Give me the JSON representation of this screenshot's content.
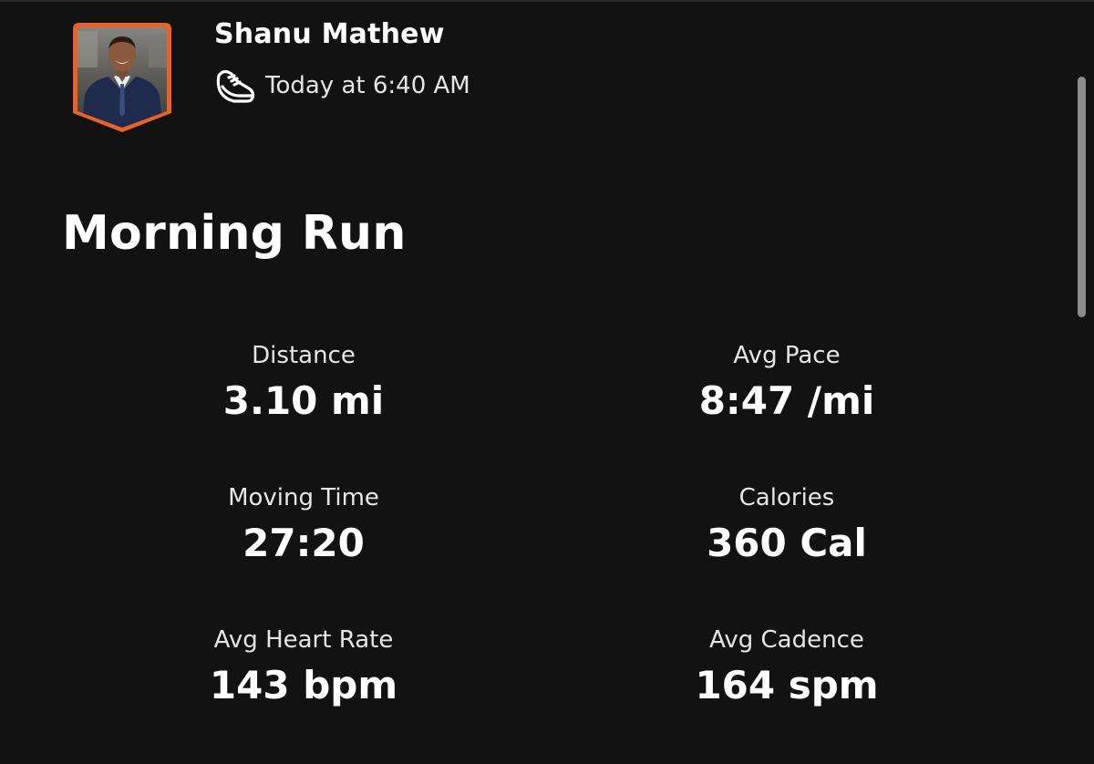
{
  "athlete": {
    "name": "Shanu Mathew",
    "avatar_icon": "athlete-avatar",
    "avatar_border_color": "#e8622c"
  },
  "activity": {
    "sport_icon": "running-shoe-icon",
    "timestamp": "Today at 6:40 AM",
    "title": "Morning Run"
  },
  "stats": [
    {
      "label": "Distance",
      "value": "3.10 mi"
    },
    {
      "label": "Avg Pace",
      "value": "8:47 /mi"
    },
    {
      "label": "Moving Time",
      "value": "27:20"
    },
    {
      "label": "Calories",
      "value": "360 Cal"
    },
    {
      "label": "Avg Heart Rate",
      "value": "143 bpm"
    },
    {
      "label": "Avg Cadence",
      "value": "164 spm"
    }
  ],
  "theme": {
    "background": "#121212",
    "text_primary": "#ffffff",
    "text_secondary": "#e6e6e6"
  }
}
